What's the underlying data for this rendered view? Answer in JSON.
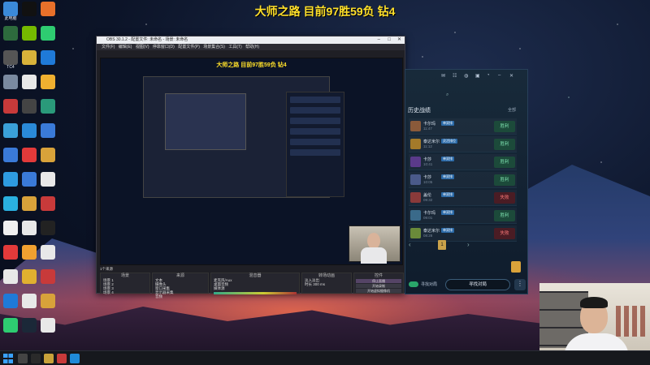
{
  "stream_title": "大师之路 目前97胜59负 钻4",
  "desktop": {
    "icons": [
      {
        "label": "此电脑",
        "icon": "computer-icon",
        "color": "#3b8ad9"
      },
      {
        "label": "",
        "icon": "app-icon",
        "color": "#2d6b3d"
      },
      {
        "label": "TC4",
        "icon": "app-icon",
        "color": "#555"
      },
      {
        "label": "",
        "icon": "recycle-bin-icon",
        "color": "#7a8aa0"
      },
      {
        "label": "",
        "icon": "app-icon",
        "color": "#c83a3a"
      },
      {
        "label": "",
        "icon": "app-icon",
        "color": "#3aa0d8"
      },
      {
        "label": "",
        "icon": "app-icon",
        "color": "#3a7ad8"
      },
      {
        "label": "",
        "icon": "app-icon",
        "color": "#2e9be0"
      },
      {
        "label": "",
        "icon": "app-icon",
        "color": "#2ab0e0"
      },
      {
        "label": "",
        "icon": "app-icon",
        "color": "#f0f0f0"
      },
      {
        "label": "",
        "icon": "app-icon",
        "color": "#e23a3a"
      },
      {
        "label": "",
        "icon": "app-icon",
        "color": "#e8e8e8"
      },
      {
        "label": "",
        "icon": "app-icon",
        "color": "#1f7ad8"
      },
      {
        "label": "",
        "icon": "app-icon",
        "color": "#2ecc71"
      },
      {
        "label": "",
        "icon": "app-icon",
        "color": "#111"
      },
      {
        "label": "",
        "icon": "app-icon",
        "color": "#76b900"
      },
      {
        "label": "",
        "icon": "app-icon",
        "color": "#d8b23a"
      },
      {
        "label": "",
        "icon": "app-icon",
        "color": "#e8e8e8"
      },
      {
        "label": "",
        "icon": "app-icon",
        "color": "#444"
      },
      {
        "label": "",
        "icon": "app-icon",
        "color": "#2a8ad8"
      },
      {
        "label": "",
        "icon": "app-icon",
        "color": "#e23a3a"
      },
      {
        "label": "",
        "icon": "app-icon",
        "color": "#3a7ad8"
      },
      {
        "label": "",
        "icon": "app-icon",
        "color": "#d8a23a"
      },
      {
        "label": "",
        "icon": "app-icon",
        "color": "#e8e8e8"
      },
      {
        "label": "",
        "icon": "app-icon",
        "color": "#f0a030"
      },
      {
        "label": "",
        "icon": "app-icon",
        "color": "#e0b030"
      },
      {
        "label": "",
        "icon": "app-icon",
        "color": "#e8e8e8"
      },
      {
        "label": "",
        "icon": "app-icon",
        "color": "#1b2838"
      },
      {
        "label": "",
        "icon": "app-icon",
        "color": "#e8702a"
      },
      {
        "label": "",
        "icon": "app-icon",
        "color": "#2ecc71"
      },
      {
        "label": "",
        "icon": "app-icon",
        "color": "#1f7ad8"
      },
      {
        "label": "",
        "icon": "app-icon",
        "color": "#f0b030"
      },
      {
        "label": "",
        "icon": "app-icon",
        "color": "#2a9a7a"
      },
      {
        "label": "",
        "icon": "app-icon",
        "color": "#3a7ad8"
      },
      {
        "label": "",
        "icon": "app-icon",
        "color": "#d8a23a"
      },
      {
        "label": "",
        "icon": "app-icon",
        "color": "#e8e8e8"
      },
      {
        "label": "",
        "icon": "app-icon",
        "color": "#c83a3a"
      },
      {
        "label": "",
        "icon": "app-icon",
        "color": "#222"
      },
      {
        "label": "",
        "icon": "app-icon",
        "color": "#e8e8e8"
      },
      {
        "label": "",
        "icon": "app-icon",
        "color": "#c83a3a"
      },
      {
        "label": "",
        "icon": "app-icon",
        "color": "#d8a23a"
      },
      {
        "label": "",
        "icon": "app-icon",
        "color": "#e8e8e8"
      }
    ]
  },
  "obs": {
    "window_title": "OBS 30.1.2 - 配置文件: 未命名 - 场景: 未命名",
    "menu": "文件(F) 编辑(E) 视图(V) 停靠窗口(D) 配置文件(P) 场景集合(S) 工具(T) 帮助(H)",
    "preview_title": "大师之路 目前97胜59负 钻4",
    "docks_header": "1个来源",
    "scenes": {
      "header": "场景",
      "items": [
        "场景 1",
        "场景 2",
        "场景 3",
        "场景 4"
      ]
    },
    "sources": {
      "header": "来源",
      "items": [
        "文本",
        "摄像头",
        "窗口采集",
        "显示器采集",
        "音频"
      ]
    },
    "mixer": {
      "header": "混音器",
      "channels": [
        "麦克风/Aux",
        "桌面音频",
        "媒体源"
      ]
    },
    "transitions": {
      "header": "转场动画",
      "items": [
        "淡入淡出",
        "时长 300 ms"
      ]
    },
    "controls": {
      "header": "控件",
      "buttons": [
        "停止直播",
        "开始录制",
        "开始虚拟摄像机",
        "工作室模式",
        "设置",
        "退出"
      ]
    }
  },
  "client": {
    "nav_icons": [
      "mail-icon",
      "group-icon",
      "globe-icon",
      "wallet-icon",
      "notification-icon",
      "minimize-icon",
      "close-icon"
    ],
    "search_icon": "search-icon",
    "section_title": "历史战绩",
    "section_link": "全部",
    "matches": [
      {
        "name": "卡尔玛",
        "tag": "单双排",
        "time": "11:47",
        "result": "胜利",
        "outcome": "win",
        "champ_color": "#8a5a3a"
      },
      {
        "name": "泰达米尔",
        "tag": "灵活排位",
        "time": "11:12",
        "result": "胜利",
        "outcome": "win",
        "champ_color": "#a37a2a"
      },
      {
        "name": "卡莎",
        "tag": "单双排",
        "time": "10:41",
        "result": "胜利",
        "outcome": "win",
        "champ_color": "#5a3a8a"
      },
      {
        "name": "卡莎",
        "tag": "单双排",
        "time": "10:05",
        "result": "胜利",
        "outcome": "win",
        "champ_color": "#4a5a8a"
      },
      {
        "name": "盖伦",
        "tag": "单双排",
        "time": "09:32",
        "result": "失败",
        "outcome": "loss",
        "champ_color": "#8a3a3a"
      },
      {
        "name": "卡尔玛",
        "tag": "单双排",
        "time": "09:01",
        "result": "胜利",
        "outcome": "win",
        "champ_color": "#3a6a8a"
      },
      {
        "name": "泰达米尔",
        "tag": "单双排",
        "time": "08:28",
        "result": "失败",
        "outcome": "loss",
        "champ_color": "#6a8a3a"
      }
    ],
    "page": "1",
    "toggle_label": "寻找对局",
    "find_button": "寻找对局",
    "more_button": "⋮"
  },
  "taskbar": {
    "start_icon": "windows-start-icon",
    "pinned": [
      {
        "icon": "search-icon",
        "color": "#444"
      },
      {
        "icon": "obs-icon",
        "color": "#2a2a2a"
      },
      {
        "icon": "game-client-icon",
        "color": "#c8a23a"
      },
      {
        "icon": "browser-icon",
        "color": "#c83a3a"
      },
      {
        "icon": "edge-icon",
        "color": "#1f8ad8"
      }
    ]
  }
}
